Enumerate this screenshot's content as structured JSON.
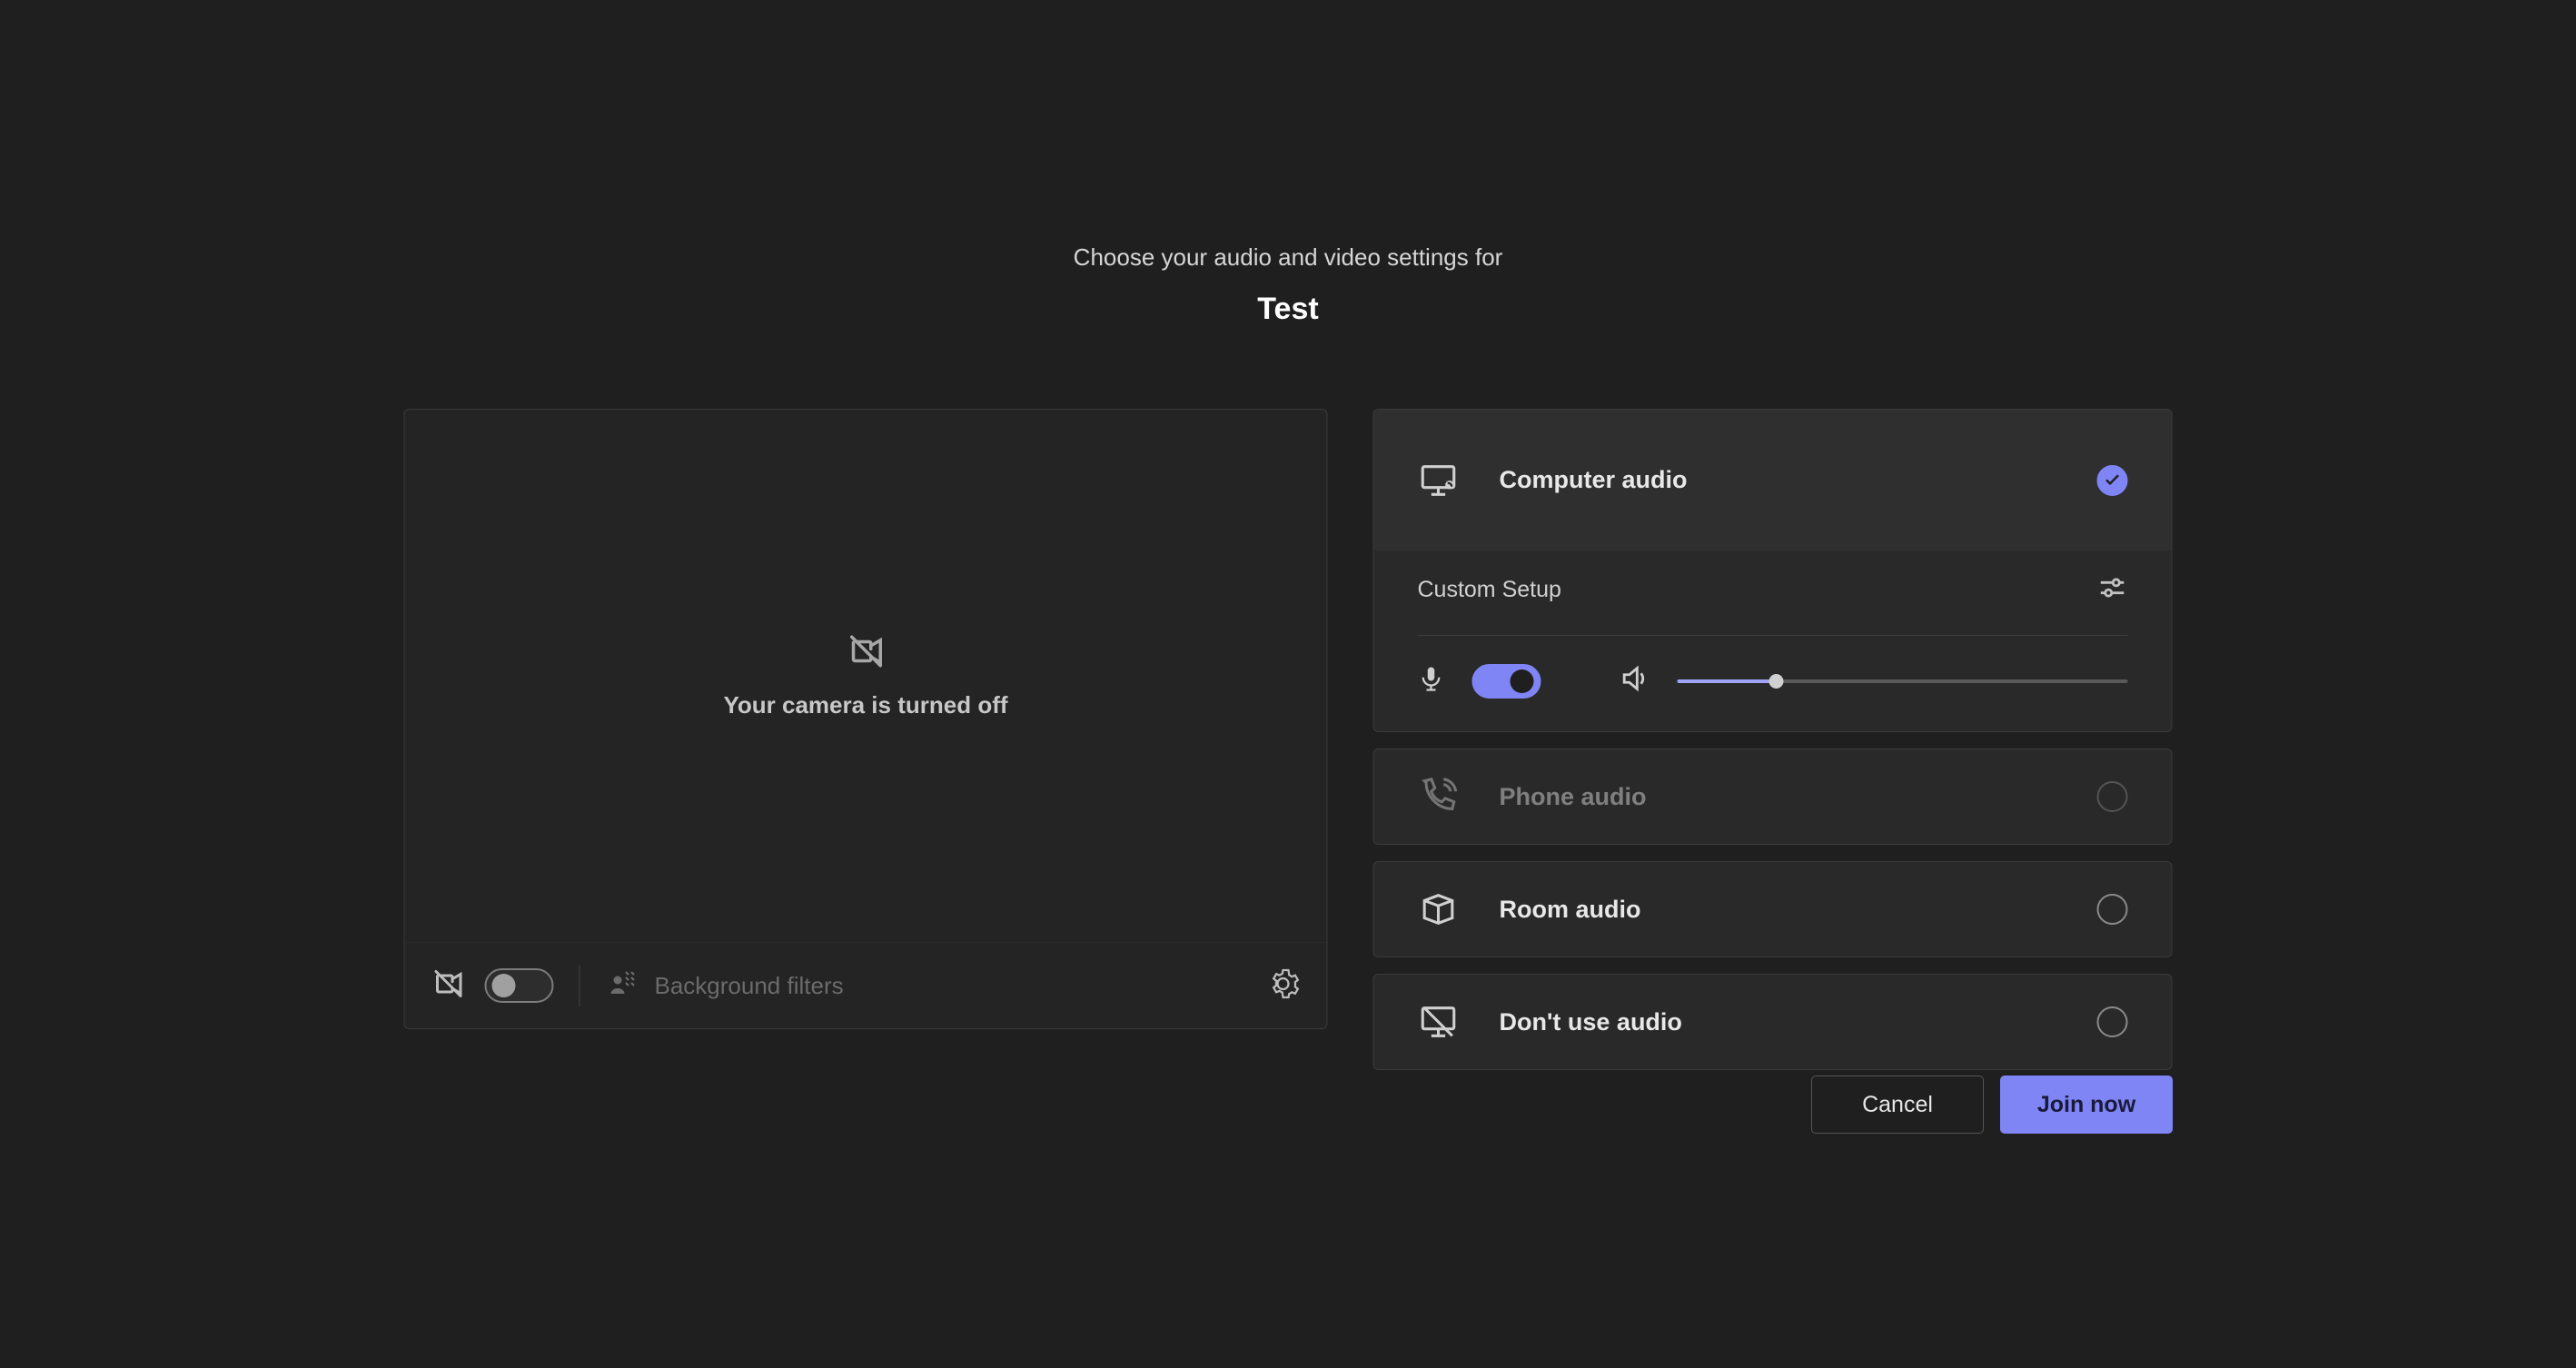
{
  "header": {
    "subtitle": "Choose your audio and video settings for",
    "title": "Test"
  },
  "video": {
    "camera_off_message": "Your camera is turned off",
    "background_filters_label": "Background filters",
    "camera_toggle_on": false
  },
  "audio": {
    "options": {
      "computer": {
        "label": "Computer audio",
        "selected": true
      },
      "phone": {
        "label": "Phone audio",
        "disabled": true
      },
      "room": {
        "label": "Room audio"
      },
      "none": {
        "label": "Don't use audio"
      }
    },
    "custom_setup_label": "Custom Setup",
    "mic_toggle_on": true,
    "volume_percent": 22
  },
  "footer": {
    "cancel": "Cancel",
    "join": "Join now"
  }
}
